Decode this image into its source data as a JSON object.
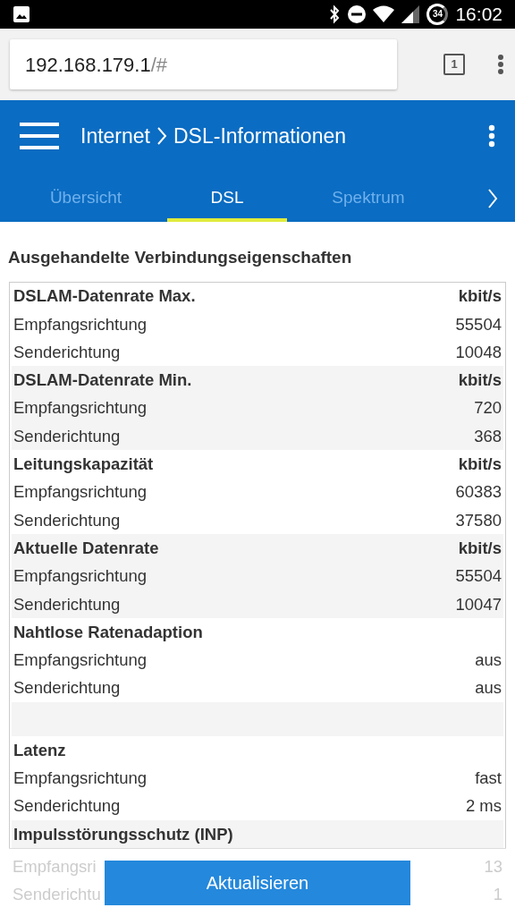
{
  "status_bar": {
    "battery": "34",
    "time": "16:02"
  },
  "browser": {
    "url_host": "192.168.179.1",
    "url_path": "/#",
    "tab_count": "1"
  },
  "header": {
    "breadcrumb": [
      "Internet",
      "DSL-Informationen"
    ]
  },
  "tabs": [
    {
      "label": "Übersicht",
      "selected": false
    },
    {
      "label": "DSL",
      "selected": true
    },
    {
      "label": "Spektrum",
      "selected": false
    }
  ],
  "section_title": "Ausgehandelte Verbindungseigenschaften",
  "table": [
    {
      "kind": "group",
      "title": "DSLAM-Datenrate Max.",
      "unit": "kbit/s",
      "rows": [
        {
          "label": "Empfangsrichtung",
          "value": "55504"
        },
        {
          "label": "Senderichtung",
          "value": "10048"
        }
      ]
    },
    {
      "kind": "group",
      "title": "DSLAM-Datenrate Min.",
      "unit": "kbit/s",
      "rows": [
        {
          "label": "Empfangsrichtung",
          "value": "720"
        },
        {
          "label": "Senderichtung",
          "value": "368"
        }
      ]
    },
    {
      "kind": "group",
      "title": "Leitungskapazität",
      "unit": "kbit/s",
      "rows": [
        {
          "label": "Empfangsrichtung",
          "value": "60383"
        },
        {
          "label": "Senderichtung",
          "value": "37580"
        }
      ]
    },
    {
      "kind": "group",
      "title": "Aktuelle Datenrate",
      "unit": "kbit/s",
      "rows": [
        {
          "label": "Empfangsrichtung",
          "value": "55504"
        },
        {
          "label": "Senderichtung",
          "value": "10047"
        }
      ]
    },
    {
      "kind": "group",
      "title": "Nahtlose Ratenadaption",
      "rows": [
        {
          "label": "Empfangsrichtung",
          "value": "aus"
        },
        {
          "label": "Senderichtung",
          "value": "aus"
        }
      ]
    },
    {
      "kind": "spacer"
    },
    {
      "kind": "group",
      "title": "Latenz",
      "rows": [
        {
          "label": "Empfangsrichtung",
          "value": "fast"
        },
        {
          "label": "Senderichtung",
          "value": "2 ms"
        }
      ]
    },
    {
      "kind": "group",
      "title": "Impulsstörungsschutz (INP)"
    }
  ],
  "obscured_rows": [
    {
      "label": "Empfangsri",
      "value": "13"
    },
    {
      "label": "Senderichtu",
      "value": "1"
    }
  ],
  "refresh_button": "Aktualisieren"
}
